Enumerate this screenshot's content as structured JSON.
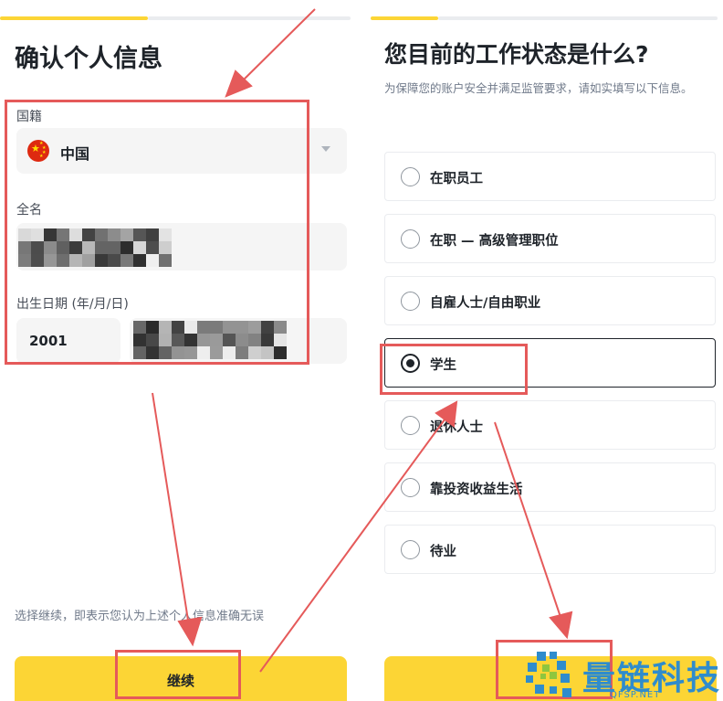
{
  "left": {
    "title": "确认个人信息",
    "nationality_label": "国籍",
    "nationality_value": "中国",
    "fullname_label": "全名",
    "dob_label": "出生日期 (年/月/日)",
    "dob_year": "2001",
    "confirm_text": "选择继续，即表示您认为上述个人信息准确无误",
    "continue_label": "继续"
  },
  "right": {
    "title": "您目前的工作状态是什么?",
    "subtitle": "为保障您的账户安全并满足监管要求，请如实填写以下信息。",
    "options": [
      {
        "label": "在职员工",
        "selected": false
      },
      {
        "label": "在职 — 高级管理职位",
        "selected": false
      },
      {
        "label": "自雇人士/自由职业",
        "selected": false
      },
      {
        "label": "学生",
        "selected": true
      },
      {
        "label": "退休人士",
        "selected": false
      },
      {
        "label": "靠投资收益生活",
        "selected": false
      },
      {
        "label": "待业",
        "selected": false
      }
    ]
  },
  "watermark": {
    "text": "量链科技",
    "sub": "QFSP.NET"
  },
  "colors": {
    "accent": "#fcd535",
    "annotation": "#e55a5a",
    "watermark": "#2f8ccc"
  },
  "icons": {
    "flag": "china-flag-icon",
    "dropdown": "caret-down-icon",
    "radio": "radio-icon"
  }
}
